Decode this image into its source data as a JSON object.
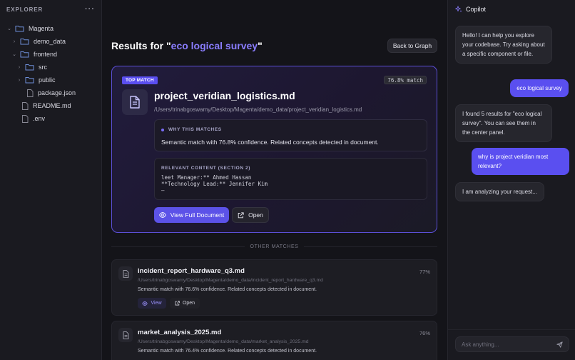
{
  "explorer": {
    "title": "EXPLORER",
    "menu": "···",
    "tree": [
      {
        "label": "Magenta",
        "type": "folder",
        "expanded": true
      },
      {
        "label": "demo_data",
        "type": "folder",
        "expanded": false
      },
      {
        "label": "frontend",
        "type": "folder",
        "expanded": true
      },
      {
        "label": "src",
        "type": "folder",
        "expanded": false
      },
      {
        "label": "public",
        "type": "folder",
        "expanded": false
      },
      {
        "label": "package.json",
        "type": "file"
      },
      {
        "label": "README.md",
        "type": "file"
      },
      {
        "label": ".env",
        "type": "file"
      }
    ]
  },
  "main": {
    "results_prefix": "Results for \"",
    "query": "eco logical survey",
    "results_suffix": "\"",
    "back_label": "Back to Graph",
    "top_match": {
      "badge": "TOP MATCH",
      "percent": "76.8% match",
      "name": "project_veridian_logistics.md",
      "path": "/Users/trinabgoswamy/Desktop/Magenta/demo_data/project_veridian_logistics.md",
      "why_label": "WHY THIS MATCHES",
      "why_text": "Semantic match with 76.8% confidence. Related concepts detected in document.",
      "relevant_label": "RELEVANT CONTENT (SECTION 2)",
      "relevant_lines": [
        "leet Manager:** Ahmed Hassan",
        "**Technology Lead:** Jennifer Kim",
        "—"
      ],
      "view_label": "View Full Document",
      "open_label": "Open"
    },
    "other_label": "OTHER MATCHES",
    "other_matches": [
      {
        "name": "incident_report_hardware_q3.md",
        "path": "/Users/trinabgoswamy/Desktop/Magenta/demo_data/incident_report_hardware_q3.md",
        "desc": "Semantic match with 76.6% confidence. Related concepts detected in document.",
        "percent": "77%",
        "view": "View",
        "open": "Open"
      },
      {
        "name": "market_analysis_2025.md",
        "path": "/Users/trinabgoswamy/Desktop/Magenta/demo_data/market_analysis_2025.md",
        "desc": "Semantic match with 76.4% confidence. Related concepts detected in document.",
        "percent": "76%"
      }
    ]
  },
  "copilot": {
    "title": "Copilot",
    "messages": [
      {
        "role": "ai",
        "text": "Hello! I can help you explore your codebase. Try asking about a specific component or file."
      },
      {
        "role": "user",
        "text": "eco logical survey"
      },
      {
        "role": "ai",
        "text": "I found 5 results for \"eco logical survey\". You can see them in the center panel."
      },
      {
        "role": "user",
        "text": "why is project veridian most relevant?"
      },
      {
        "role": "ai",
        "text": "I am analyzing your request..."
      }
    ],
    "input_placeholder": "Ask anything..."
  },
  "colors": {
    "accent": "#5c52e8",
    "accent_text": "#8a7dff",
    "background": "#141419",
    "panel": "#1a1a20"
  }
}
